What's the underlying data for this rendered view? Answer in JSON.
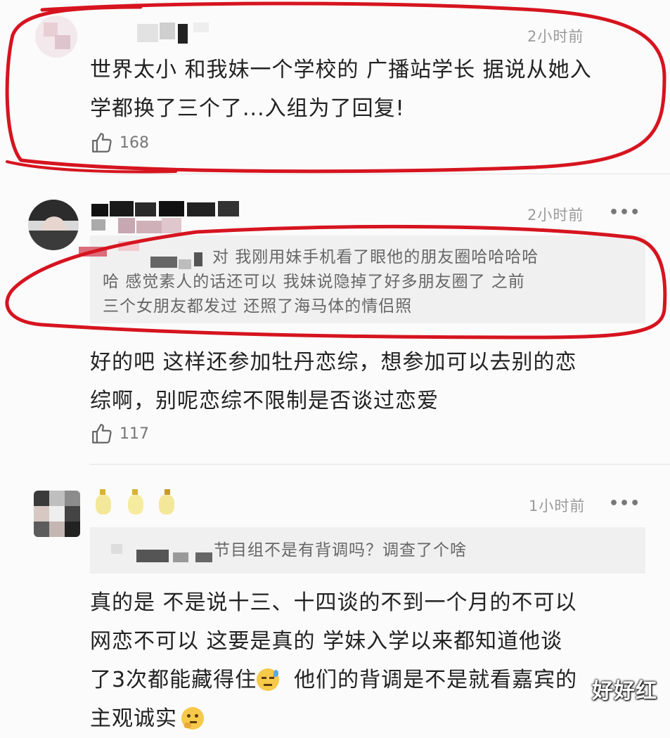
{
  "colors": {
    "accent_red": "#d6141f",
    "text": "#222222",
    "muted": "#9a9a9a",
    "reply_bg": "#f0f0f0"
  },
  "comments": [
    {
      "time": "2小时前",
      "text_lines": [
        "世界太小 和我妹一个学校的 广播站学长 据说从她入",
        "学都换了三个了...入组为了回复!"
      ],
      "likes": "168",
      "like_icon": "thumbs-up-icon"
    },
    {
      "time": "2小时前",
      "more": "•••",
      "reply_lines": [
        "对 我刚用妹手机看了眼他的朋友圈哈哈哈哈",
        "哈 感觉素人的话还可以 我妹说隐掉了好多朋友圈了 之前",
        "三个女朋友都发过 还照了海马体的情侣照"
      ],
      "text_lines": [
        "好的吧 这样还参加牡丹恋综，想参加可以去别的恋",
        "综啊，别呢恋综不限制是否谈过恋爱"
      ],
      "likes": "117",
      "like_icon": "thumbs-up-icon"
    },
    {
      "time": "1小时前",
      "more": "•••",
      "reply_lines": [
        "节目组不是有背调吗？调查了个啥"
      ],
      "text_lines": [
        "真的是  不是说十三、十四谈的不到一个月的不可以",
        "网恋不可以   这要是真的  学妹入学以来都知道他谈",
        "了3次都能藏得住",
        "他们的背调是不是就看嘉宾的",
        "主观诚实"
      ],
      "emojis": [
        "sweat-face-icon",
        "thinking-face-icon"
      ]
    }
  ],
  "watermark": "好好红"
}
